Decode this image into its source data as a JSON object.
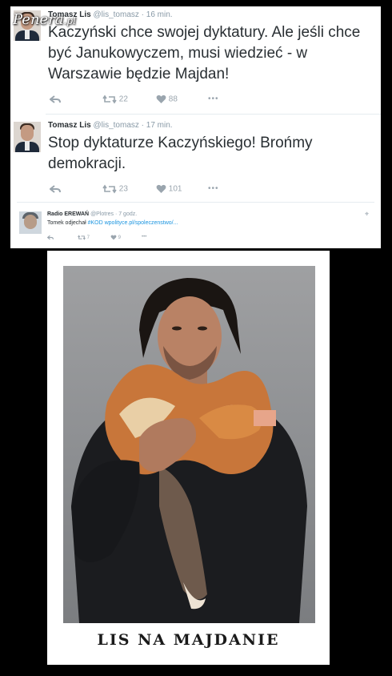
{
  "watermark": {
    "name": "Penera",
    "domain": ".pl"
  },
  "tweets": [
    {
      "name": "Tomasz Lis",
      "handle": "@lis_tomasz",
      "time": "· 16 min.",
      "text": "Kaczyński chce swojej dyktatury. Ale jeśli chce być Janukowyczem, musi wiedzieć - w Warszawie będzie Majdan!",
      "retweets": "22",
      "likes": "88",
      "more": "•••"
    },
    {
      "name": "Tomasz Lis",
      "handle": "@lis_tomasz",
      "time": "· 17 min.",
      "text": "Stop dyktaturze Kaczyńskiego! Brońmy demokracji.",
      "retweets": "23",
      "likes": "101",
      "more": "•••"
    },
    {
      "name": "Radio EREWAŃ",
      "handle": "@Plotres",
      "time": "· 7 godz.",
      "text_prefix": "Tomek odjechał ",
      "hashtag": "#KOD",
      "link": "wpolityce.pl/spoleczenstwo/...",
      "retweets": "7",
      "likes": "9",
      "more": "•••"
    }
  ],
  "poster": {
    "caption": "LIS NA MAJDANIE"
  },
  "colors": {
    "text": "#292f33",
    "muted": "#8899a6",
    "link": "#1b95e0",
    "icon": "#9aa5ae"
  }
}
